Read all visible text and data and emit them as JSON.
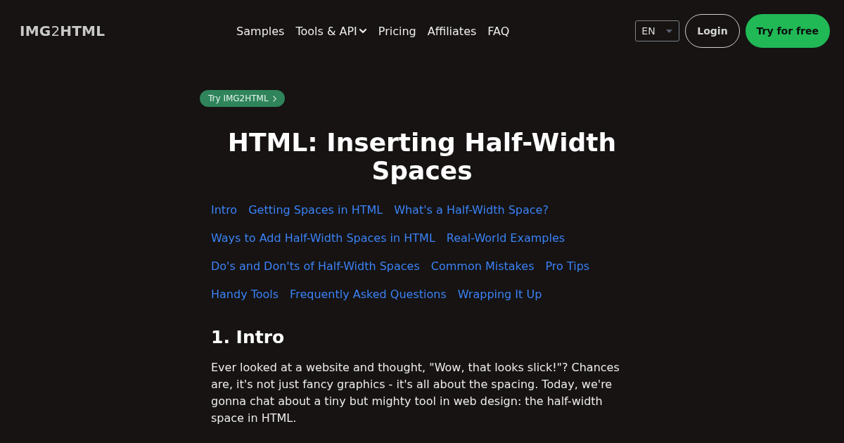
{
  "header": {
    "logo": "**IMG**2**HTML**",
    "nav": [
      {
        "label": "Samples",
        "kind": "link"
      },
      {
        "label": "Tools & API",
        "kind": "dropdown"
      },
      {
        "label": "Pricing",
        "kind": "link"
      },
      {
        "label": "Affiliates",
        "kind": "link"
      },
      {
        "label": "FAQ",
        "kind": "link"
      }
    ],
    "language": "EN",
    "login": "Login",
    "cta": "Try for free"
  },
  "badge": "Try IMG2HTML",
  "title": "HTML: Inserting Half-Width Spaces",
  "toc": [
    "Intro",
    "Getting Spaces in HTML",
    "What's a Half-Width Space?",
    "Ways to Add Half-Width Spaces in HTML",
    "Real-World Examples",
    "Do's and Don'ts of Half-Width Spaces",
    "Common Mistakes",
    "Pro Tips",
    "Handy Tools",
    "Frequently Asked Questions",
    "Wrapping It Up"
  ],
  "section": {
    "heading": "1. Intro",
    "paragraphs": [
      "Ever looked at a website and thought, \"Wow, that looks slick!\"? Chances are, it's not just fancy graphics - it's all about the spacing. Today, we're gonna chat about a tiny but mighty tool in web design: the half-width space in HTML."
    ]
  }
}
